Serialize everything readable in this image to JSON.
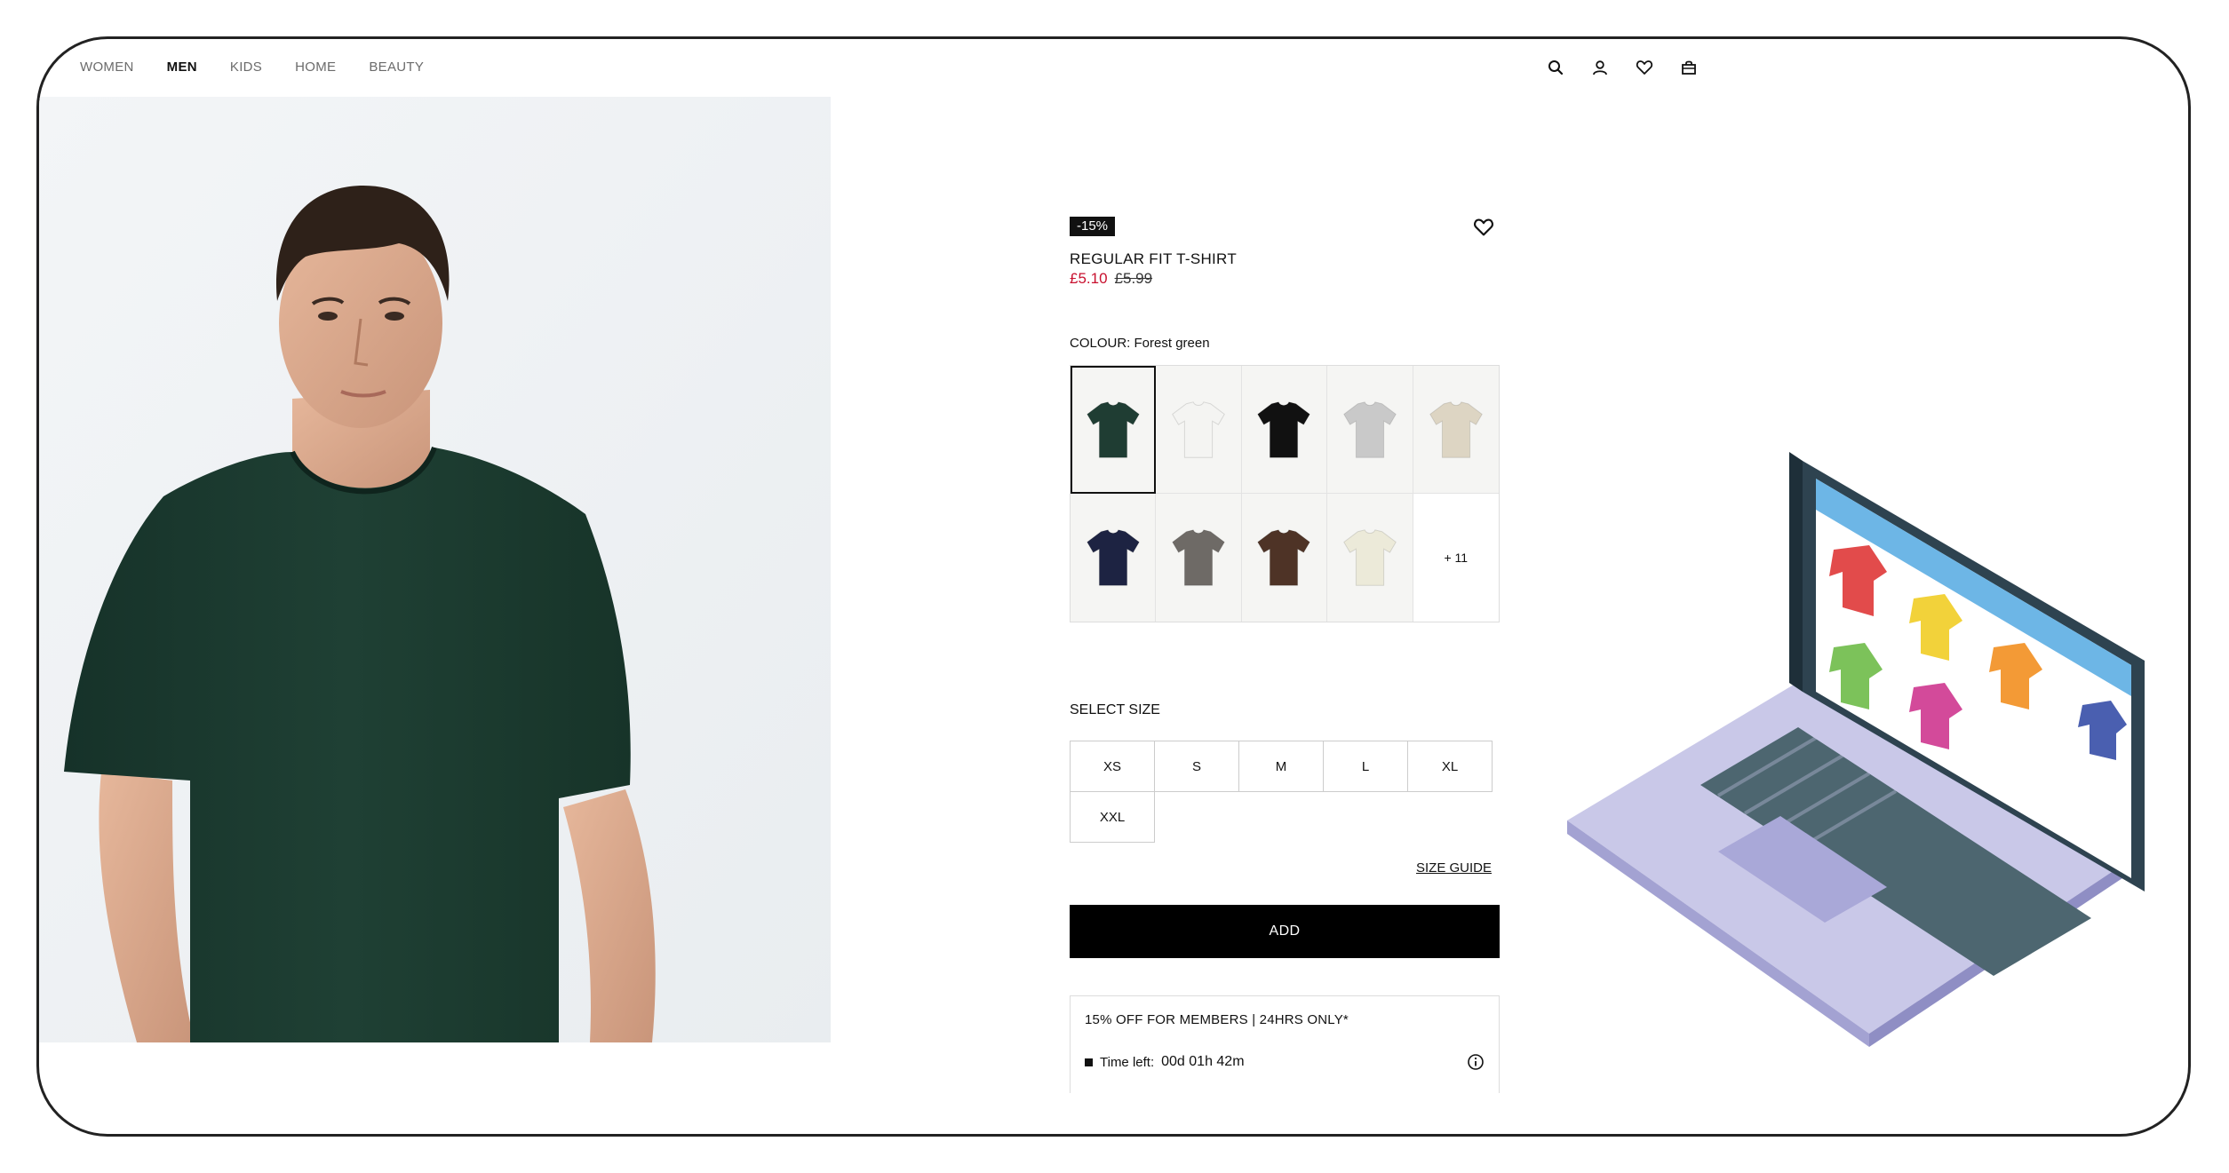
{
  "nav": {
    "items": [
      {
        "label": "WOMEN",
        "active": false
      },
      {
        "label": "MEN",
        "active": true
      },
      {
        "label": "KIDS",
        "active": false
      },
      {
        "label": "HOME",
        "active": false
      },
      {
        "label": "BEAUTY",
        "active": false
      }
    ],
    "icons": [
      "search-icon",
      "account-icon",
      "favourites-icon",
      "bag-icon"
    ]
  },
  "product": {
    "badge": "-15%",
    "title": "REGULAR FIT T-SHIRT",
    "sale_price": "£5.10",
    "original_price": "£5.99",
    "colour_label": "COLOUR:",
    "colour_value": "Forest green",
    "swatches": [
      {
        "name": "Forest green",
        "hex": "#1f3d33",
        "selected": true
      },
      {
        "name": "White",
        "hex": "#f4f4f2",
        "selected": false
      },
      {
        "name": "Black",
        "hex": "#111111",
        "selected": false
      },
      {
        "name": "Light grey",
        "hex": "#c9c9c9",
        "selected": false
      },
      {
        "name": "Beige",
        "hex": "#ddd5c3",
        "selected": false
      },
      {
        "name": "Navy",
        "hex": "#1d2342",
        "selected": false
      },
      {
        "name": "Dark grey",
        "hex": "#6e6a66",
        "selected": false
      },
      {
        "name": "Brown",
        "hex": "#4e3326",
        "selected": false
      },
      {
        "name": "Cream",
        "hex": "#ecead9",
        "selected": false
      }
    ],
    "more_colours": "+ 11",
    "size_label": "SELECT SIZE",
    "sizes": [
      "XS",
      "S",
      "M",
      "L",
      "XL",
      "XXL"
    ],
    "size_guide": "SIZE GUIDE",
    "add_label": "ADD",
    "promo_text": "15% OFF FOR MEMBERS | 24HRS ONLY*",
    "time_left_label": "Time left:",
    "time_left_value": "00d 01h 42m"
  },
  "colors": {
    "sale_red": "#c8102e",
    "shirt_green": "#1f3d33"
  }
}
